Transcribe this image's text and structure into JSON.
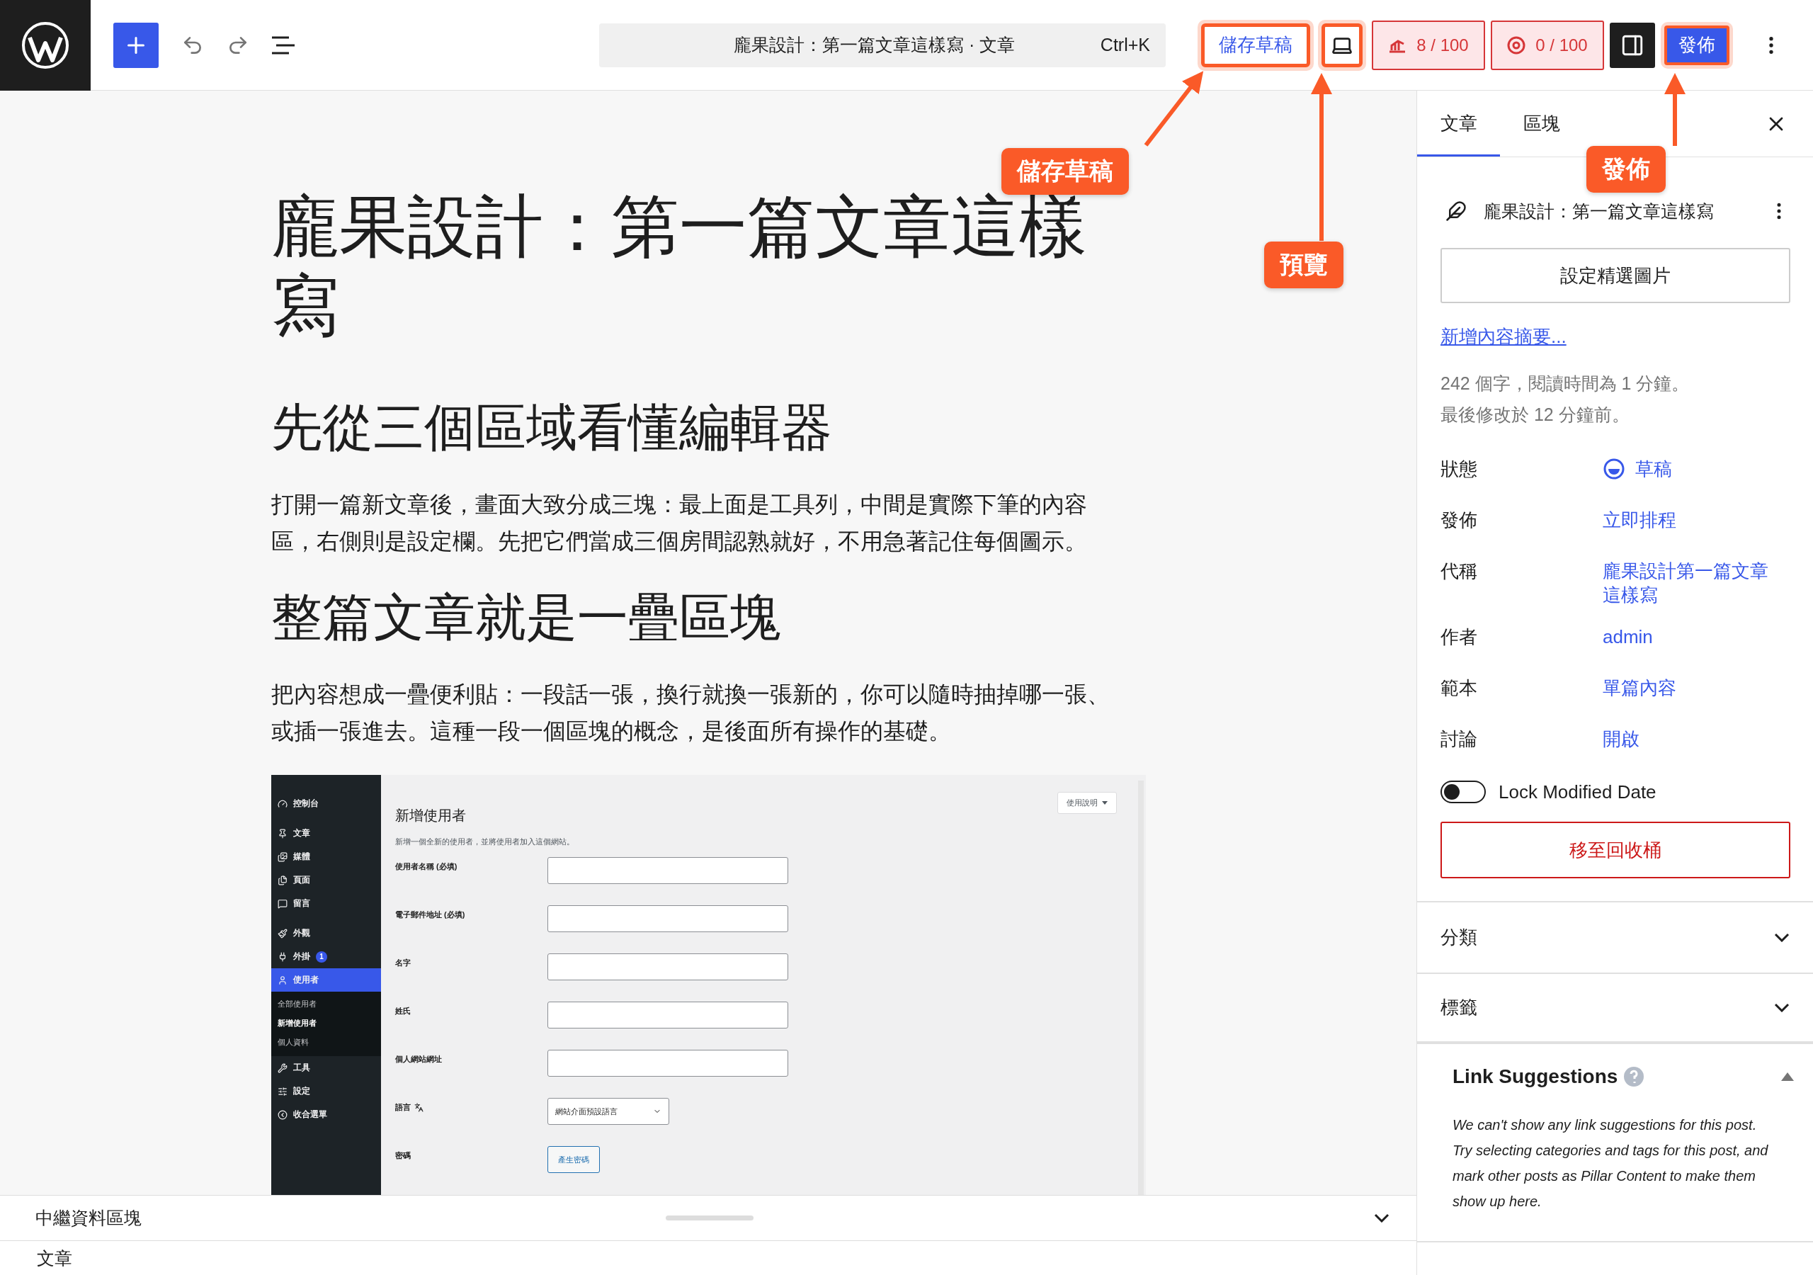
{
  "toolbar": {
    "command_bar": {
      "title": "龐果設計：第一篇文章這樣寫 · 文章",
      "shortcut": "Ctrl+K"
    },
    "save_draft": {
      "label": "儲存草稿",
      "highlighted": true
    },
    "preview": {
      "highlighted": true
    },
    "scores": [
      {
        "label": "8 / 100"
      },
      {
        "label": "0 / 100"
      }
    ],
    "settings_toggle": {
      "on": true
    },
    "publish": {
      "label": "發佈",
      "highlighted": true
    }
  },
  "annotations": [
    {
      "label": "儲存草稿"
    },
    {
      "label": "預覽"
    },
    {
      "label": "發佈"
    }
  ],
  "editor": {
    "title": "龐果設計：第一篇文章這樣寫",
    "blocks": [
      {
        "kind": "heading",
        "text": "先從三個區域看懂編輯器"
      },
      {
        "kind": "paragraph",
        "text": "打開一篇新文章後，畫面大致分成三塊：最上面是工具列，中間是實際下筆的內容區，右側則是設定欄。先把它們當成三個房間認熟就好，不用急著記住每個圖示。"
      },
      {
        "kind": "heading",
        "text": "整篇文章就是一疊區塊"
      },
      {
        "kind": "paragraph",
        "text": "把內容想成一疊便利貼：一段話一張，換行就換一張新的，你可以隨時抽掉哪一張、或插一張進去。這種一段一個區塊的概念，是後面所有操作的基礎。"
      },
      {
        "kind": "image",
        "screenshot": {
          "menu": [
            {
              "label": "控制台",
              "selected": false
            },
            {
              "label": "文章",
              "selected": false
            },
            {
              "label": "媒體",
              "selected": false
            },
            {
              "label": "頁面",
              "selected": false
            },
            {
              "label": "留言",
              "selected": false
            },
            {
              "label": "外觀",
              "selected": false
            },
            {
              "label": "外掛",
              "selected": false,
              "badge": "1"
            },
            {
              "label": "使用者",
              "selected": true,
              "children": [
                {
                  "label": "全部使用者",
                  "selected": false
                },
                {
                  "label": "新增使用者",
                  "selected": true
                },
                {
                  "label": "個人資料",
                  "selected": false
                }
              ]
            },
            {
              "label": "工具",
              "selected": false
            },
            {
              "label": "設定",
              "selected": false
            },
            {
              "label": "收合選單",
              "selected": false
            }
          ],
          "help": "使用說明",
          "title": "新增使用者",
          "description": "新增一個全新的使用者，並將使用者加入這個網站。",
          "fields": [
            {
              "kind": "text",
              "label": "使用者名稱 (必填)"
            },
            {
              "kind": "text",
              "label": "電子郵件地址 (必填)"
            },
            {
              "kind": "text",
              "label": "名字"
            },
            {
              "kind": "text",
              "label": "姓氏"
            },
            {
              "kind": "text",
              "label": "個人網站網址"
            },
            {
              "kind": "select",
              "label": "語言",
              "value": "網站介面預設語言"
            },
            {
              "kind": "button",
              "label": "密碼",
              "value": "產生密碼"
            }
          ]
        }
      }
    ]
  },
  "bottom_panel": {
    "title": "中繼資料區塊",
    "expanded": false
  },
  "breadcrumb": "文章",
  "sidebar": {
    "tabs": [
      {
        "label": "文章",
        "selected": true
      },
      {
        "label": "區塊",
        "selected": false
      }
    ],
    "post_title": "龐果設計：第一篇文章這樣寫",
    "featured_image": "設定精選圖片",
    "excerpt_link": "新增內容摘要...",
    "stats": [
      "242 個字，閱讀時間為 1 分鐘。",
      "最後修改於 12 分鐘前。"
    ],
    "rows": [
      {
        "label": "狀態",
        "value": "草稿",
        "kind": "status"
      },
      {
        "label": "發佈",
        "value": "立即排程",
        "kind": "link"
      },
      {
        "label": "代稱",
        "value": "龐果設計第一篇文章這樣寫",
        "kind": "link"
      },
      {
        "label": "作者",
        "value": "admin",
        "kind": "link"
      },
      {
        "label": "範本",
        "value": "單篇內容",
        "kind": "link"
      },
      {
        "label": "討論",
        "value": "開啟",
        "kind": "link"
      }
    ],
    "lock_modified": {
      "label": "Lock Modified Date",
      "on": false
    },
    "trash": "移至回收桶",
    "panels": [
      {
        "title": "分類",
        "expanded": false
      },
      {
        "title": "標籤",
        "expanded": false
      }
    ],
    "link_suggestions": {
      "title": "Link Suggestions",
      "expanded": true,
      "text": "We can't show any link suggestions for this post. Try selecting categories and tags for this post, and mark other posts as Pillar Content to make them show up here."
    }
  }
}
